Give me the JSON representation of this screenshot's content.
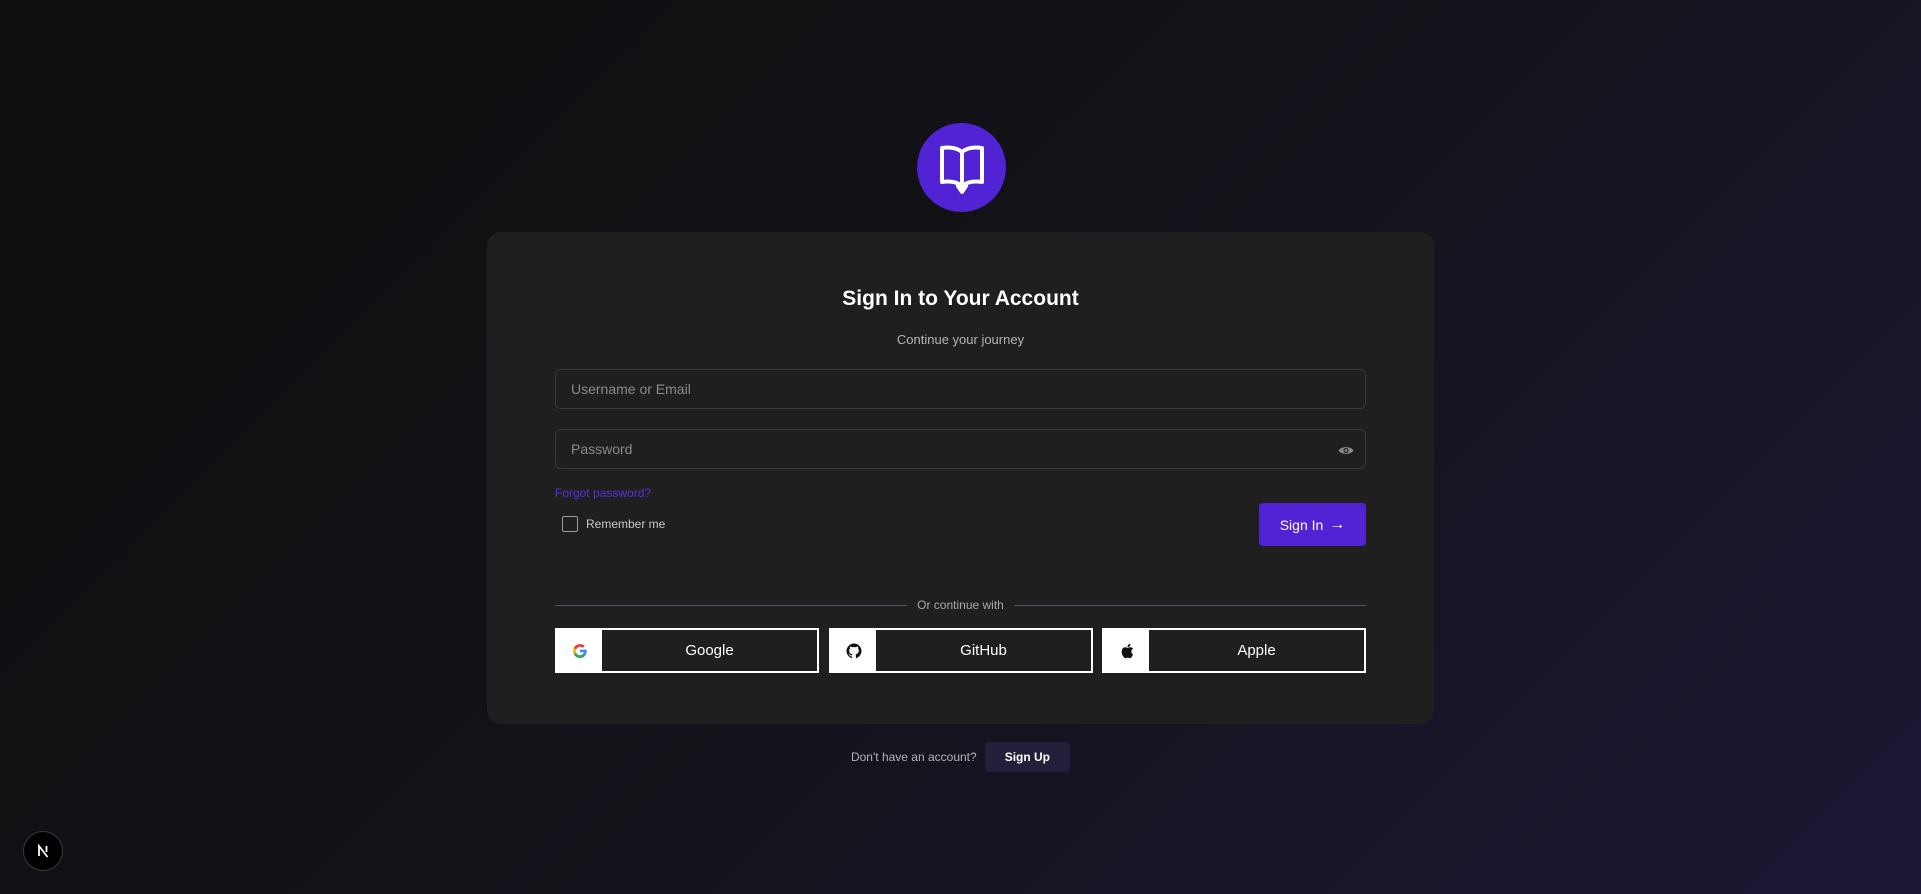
{
  "logo": {
    "icon": "book-open-icon",
    "color": "#5223d4"
  },
  "card": {
    "title": "Sign In to Your Account",
    "subtitle": "Continue your journey"
  },
  "form": {
    "username_placeholder": "Username or Email",
    "username_value": "",
    "password_placeholder": "Password",
    "password_value": "",
    "forgot_label": "Forgot password?",
    "remember_label": "Remember me",
    "remember_checked": false,
    "signin_label": "Sign In",
    "signin_arrow": "→"
  },
  "social": {
    "divider_label": "Or continue with",
    "providers": [
      {
        "label": "Google",
        "icon": "google-icon"
      },
      {
        "label": "GitHub",
        "icon": "github-icon"
      },
      {
        "label": "Apple",
        "icon": "apple-icon"
      }
    ]
  },
  "footer": {
    "prompt": "Don't have an account?",
    "signup_label": "Sign Up"
  },
  "dev_badge": {
    "letter": "N"
  },
  "colors": {
    "accent": "#5223d4",
    "card": "#1f1f1f",
    "link": "#5a2fe0"
  }
}
